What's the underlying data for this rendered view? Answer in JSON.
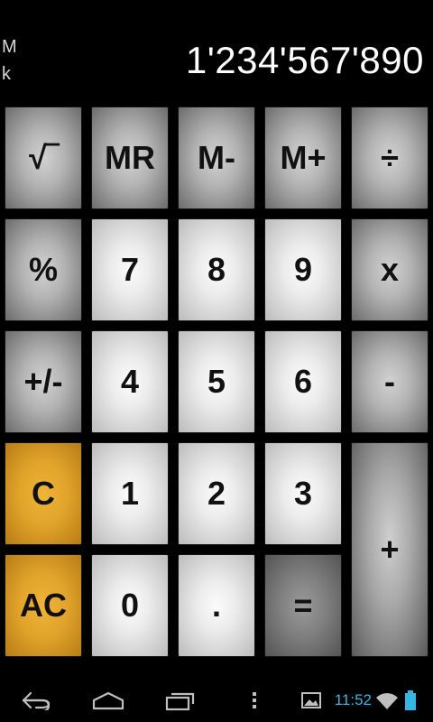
{
  "display": {
    "memory_indicator": "M",
    "unit_indicator": "k",
    "value": "1'234'567'890"
  },
  "keys": {
    "sqrt": "√‾",
    "mr": "MR",
    "m_minus": "M-",
    "m_plus": "M+",
    "divide": "÷",
    "percent": "%",
    "seven": "7",
    "eight": "8",
    "nine": "9",
    "multiply": "x",
    "sign": "+/-",
    "four": "4",
    "five": "5",
    "six": "6",
    "minus": "-",
    "clear": "C",
    "one": "1",
    "two": "2",
    "three": "3",
    "plus": "+",
    "all_clear": "AC",
    "zero": "0",
    "decimal": ".",
    "equals": "="
  },
  "colors": {
    "clear_key": "#e1a32a",
    "clock": "#33b5e5",
    "battery": "#33b5e5"
  },
  "system_bar": {
    "time": "11:52",
    "icons": [
      "back-icon",
      "home-icon",
      "recent-apps-icon",
      "menu-icon",
      "gallery-icon",
      "wifi-icon",
      "battery-icon"
    ]
  }
}
